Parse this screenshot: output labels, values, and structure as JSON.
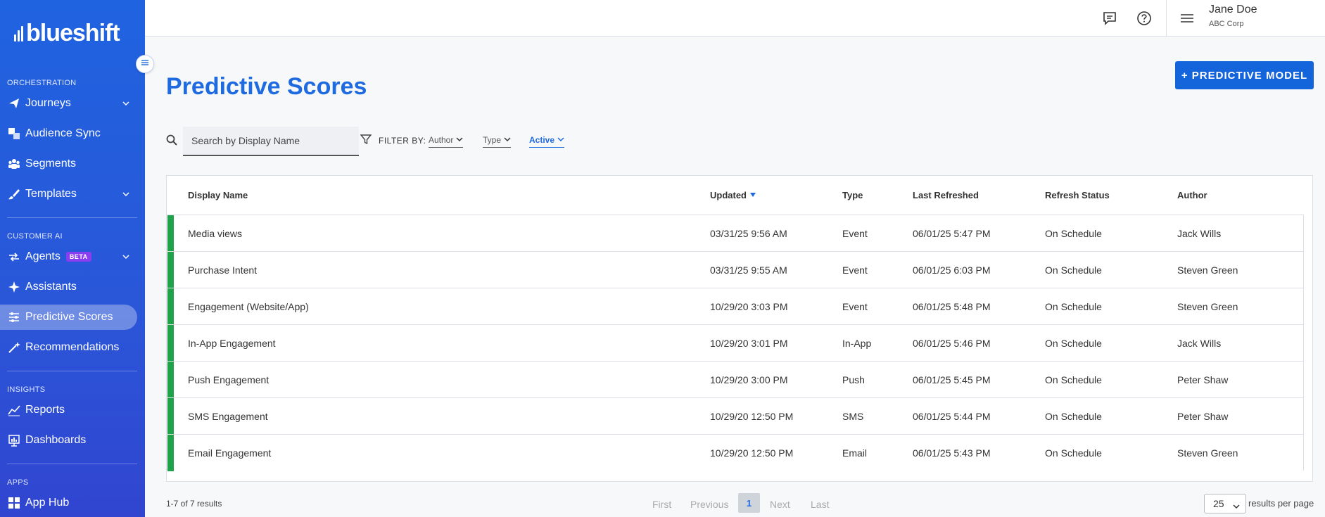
{
  "app": {
    "brand": "blueshift"
  },
  "sidebar": {
    "sections": {
      "orchestration": "ORCHESTRATION",
      "customer_ai": "CUSTOMER AI",
      "insights": "INSIGHTS",
      "apps": "APPS"
    },
    "items": [
      {
        "label": "Journeys",
        "icon": "paper-plane-icon"
      },
      {
        "label": "Audience Sync",
        "icon": "audience-sync-icon"
      },
      {
        "label": "Segments",
        "icon": "people-icon"
      },
      {
        "label": "Templates",
        "icon": "brush-icon"
      },
      {
        "label": "Agents",
        "icon": "agents-icon",
        "badge": "BETA"
      },
      {
        "label": "Assistants",
        "icon": "sparkle-icon"
      },
      {
        "label": "Predictive Scores",
        "icon": "sliders-icon",
        "active": true
      },
      {
        "label": "Recommendations",
        "icon": "magic-wand-icon"
      },
      {
        "label": "Reports",
        "icon": "chart-line-icon"
      },
      {
        "label": "Dashboards",
        "icon": "dashboard-icon"
      },
      {
        "label": "App Hub",
        "icon": "grid-icon"
      }
    ]
  },
  "header": {
    "user_name": "Jane Doe",
    "user_org": "ABC Corp"
  },
  "page": {
    "title": "Predictive Scores",
    "primary_button": "+ PREDICTIVE MODEL"
  },
  "filters": {
    "search_placeholder": "Search by Display Name",
    "filter_label": "FILTER BY:",
    "author": "Author",
    "type": "Type",
    "status": "Active"
  },
  "table": {
    "columns": {
      "display_name": "Display Name",
      "updated": "Updated",
      "type": "Type",
      "last_refreshed": "Last Refreshed",
      "refresh_status": "Refresh Status",
      "author": "Author"
    },
    "rows": [
      {
        "name": "Media views",
        "updated": "03/31/25 9:56 AM",
        "type": "Event",
        "last_refreshed": "06/01/25 5:47 PM",
        "status": "On Schedule",
        "author": "Jack Wills"
      },
      {
        "name": "Purchase Intent",
        "updated": "03/31/25 9:55 AM",
        "type": "Event",
        "last_refreshed": "06/01/25 6:03 PM",
        "status": "On Schedule",
        "author": "Steven Green"
      },
      {
        "name": "Engagement (Website/App)",
        "updated": "10/29/20 3:03 PM",
        "type": "Event",
        "last_refreshed": "06/01/25 5:48 PM",
        "status": "On Schedule",
        "author": "Steven Green"
      },
      {
        "name": "In-App Engagement",
        "updated": "10/29/20 3:01 PM",
        "type": "In-App",
        "last_refreshed": "06/01/25 5:46 PM",
        "status": "On Schedule",
        "author": "Jack Wills"
      },
      {
        "name": "Push Engagement",
        "updated": "10/29/20 3:00 PM",
        "type": "Push",
        "last_refreshed": "06/01/25 5:45 PM",
        "status": "On Schedule",
        "author": "Peter Shaw"
      },
      {
        "name": "SMS Engagement",
        "updated": "10/29/20 12:50 PM",
        "type": "SMS",
        "last_refreshed": "06/01/25 5:44 PM",
        "status": "On Schedule",
        "author": "Peter Shaw"
      },
      {
        "name": "Email Engagement",
        "updated": "10/29/20 12:50 PM",
        "type": "Email",
        "last_refreshed": "06/01/25 5:43 PM",
        "status": "On Schedule",
        "author": "Steven Green"
      }
    ]
  },
  "footer": {
    "results": "1-7 of 7 results",
    "first": "First",
    "previous": "Previous",
    "current_page": "1",
    "next": "Next",
    "last": "Last",
    "per_page_value": "25",
    "per_page_label": "results per page"
  },
  "colors": {
    "brand_blue": "#1e6ae0",
    "status_active": "#1fa34a",
    "beta_badge": "#8b3df0"
  }
}
